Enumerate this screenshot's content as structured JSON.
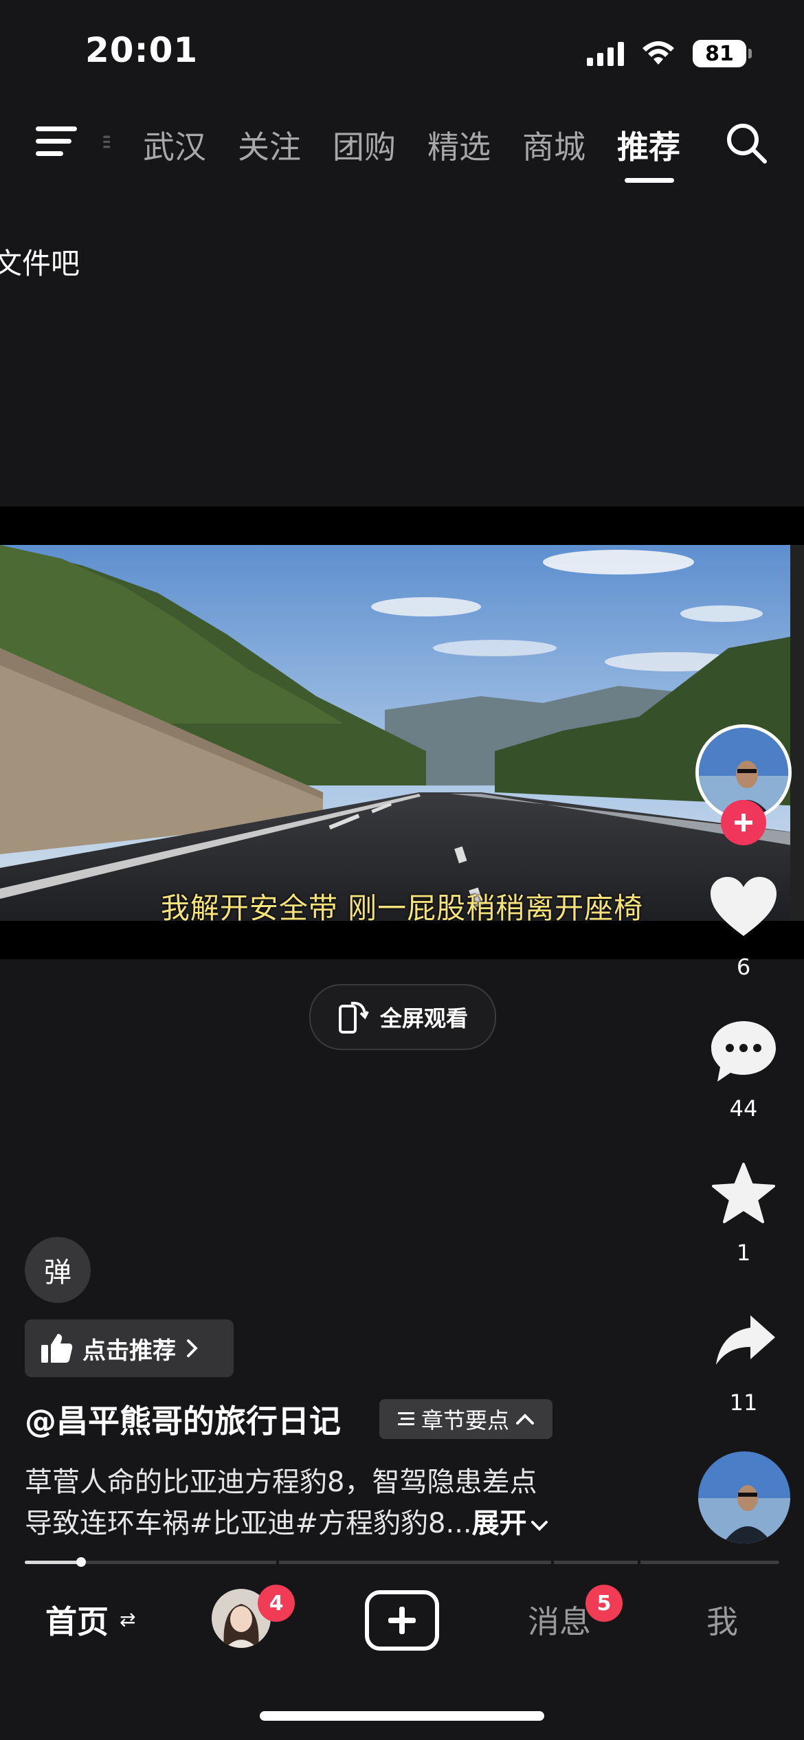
{
  "status_bar": {
    "time": "20:01",
    "battery": "81",
    "icons": [
      "signal-icon",
      "wifi-icon",
      "battery-icon"
    ]
  },
  "top_nav": {
    "tabs": [
      {
        "label": "武汉",
        "active": false
      },
      {
        "label": "关注",
        "active": false
      },
      {
        "label": "团购",
        "active": false
      },
      {
        "label": "精选",
        "active": false
      },
      {
        "label": "商城",
        "active": false
      },
      {
        "label": "推荐",
        "active": true
      }
    ],
    "icons": [
      "menu-icon",
      "search-icon"
    ]
  },
  "overlay_partial_text": "文件吧",
  "video": {
    "subtitle": "我解开安全带 刚一屁股稍稍离开座椅",
    "fullscreen_label": "全屏观看"
  },
  "right_rail": {
    "likes": "6",
    "comments": "44",
    "favorites": "1",
    "shares": "11"
  },
  "post": {
    "danmaku_label": "弹",
    "recommend_label": "点击推荐",
    "author": "@昌平熊哥的旅行日记",
    "chapter_label": "章节要点",
    "description_line1": "草菅人命的比亚迪方程豹8，智驾隐患差点",
    "description_line2": "导致连环车祸#比亚迪#方程豹豹8...",
    "expand_label": "展开",
    "progress": 0.075
  },
  "bottom_nav": {
    "home_label": "首页",
    "friends_badge": "4",
    "messages_label": "消息",
    "messages_badge": "5",
    "me_label": "我"
  },
  "colors": {
    "background": "#161618",
    "badge": "#f23c55",
    "follow_plus": "#f0365a",
    "subtitle": "#f5e27a"
  }
}
